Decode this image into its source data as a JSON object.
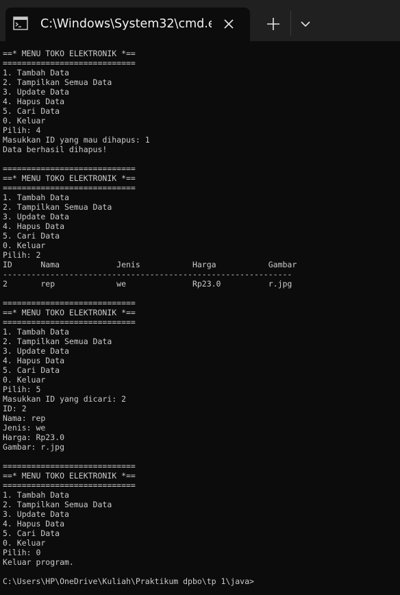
{
  "window": {
    "tab_title": "C:\\Windows\\System32\\cmd.e",
    "tab_icon": "command-prompt-icon",
    "close_icon": "close-icon",
    "new_tab_icon": "plus-icon",
    "dropdown_icon": "chevron-down-icon"
  },
  "colors": {
    "titlebar": "#202020",
    "console_background": "#0c0c0c",
    "console_text": "#cccccc"
  },
  "console": {
    "text": "==* MENU TOKO ELEKTRONIK *==\n============================\n1. Tambah Data\n2. Tampilkan Semua Data\n3. Update Data\n4. Hapus Data\n5. Cari Data\n0. Keluar\nPilih: 4\nMasukkan ID yang mau dihapus: 1\nData berhasil dihapus!\n\n============================\n==* MENU TOKO ELEKTRONIK *==\n============================\n1. Tambah Data\n2. Tampilkan Semua Data\n3. Update Data\n4. Hapus Data\n5. Cari Data\n0. Keluar\nPilih: 2\nID      Nama            Jenis           Harga           Gambar\n-------------------------------------------------------------\n2       rep             we              Rp23.0          r.jpg\n\n============================\n==* MENU TOKO ELEKTRONIK *==\n============================\n1. Tambah Data\n2. Tampilkan Semua Data\n3. Update Data\n4. Hapus Data\n5. Cari Data\n0. Keluar\nPilih: 5\nMasukkan ID yang dicari: 2\nID: 2\nNama: rep\nJenis: we\nHarga: Rp23.0\nGambar: r.jpg\n\n============================\n==* MENU TOKO ELEKTRONIK *==\n============================\n1. Tambah Data\n2. Tampilkan Semua Data\n3. Update Data\n4. Hapus Data\n5. Cari Data\n0. Keluar\nPilih: 0\nKeluar program.\n\nC:\\Users\\HP\\OneDrive\\Kuliah\\Praktikum dpbo\\tp 1\\java>"
  }
}
